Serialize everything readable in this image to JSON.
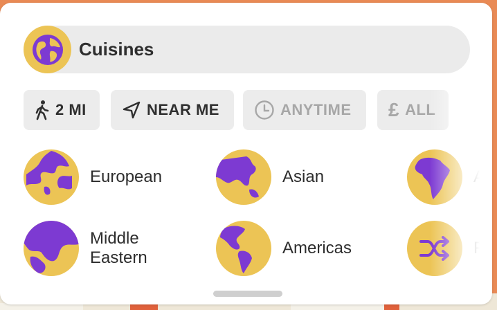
{
  "header": {
    "title": "Cuisines",
    "icon": "globe-icon"
  },
  "filters": [
    {
      "label": "2 MI",
      "icon": "walking-icon",
      "active": true
    },
    {
      "label": "NEAR ME",
      "icon": "location-arrow-icon",
      "active": true
    },
    {
      "label": "ANYTIME",
      "icon": "clock-icon",
      "active": false
    },
    {
      "label": "ALL",
      "icon": "pound-icon",
      "active": false
    }
  ],
  "categories": [
    {
      "label": "European",
      "icon": "globe-europe-icon"
    },
    {
      "label": "Asian",
      "icon": "globe-asia-icon"
    },
    {
      "label": "Af",
      "icon": "globe-africa-icon"
    },
    {
      "label": "Middle Eastern",
      "icon": "globe-middle-east-icon"
    },
    {
      "label": "Americas",
      "icon": "globe-americas-icon"
    },
    {
      "label": "Fu",
      "icon": "shuffle-icon"
    }
  ],
  "colors": {
    "accent_gold": "#ecc455",
    "accent_purple": "#7d3ad2",
    "chip_bg": "#ececec"
  }
}
